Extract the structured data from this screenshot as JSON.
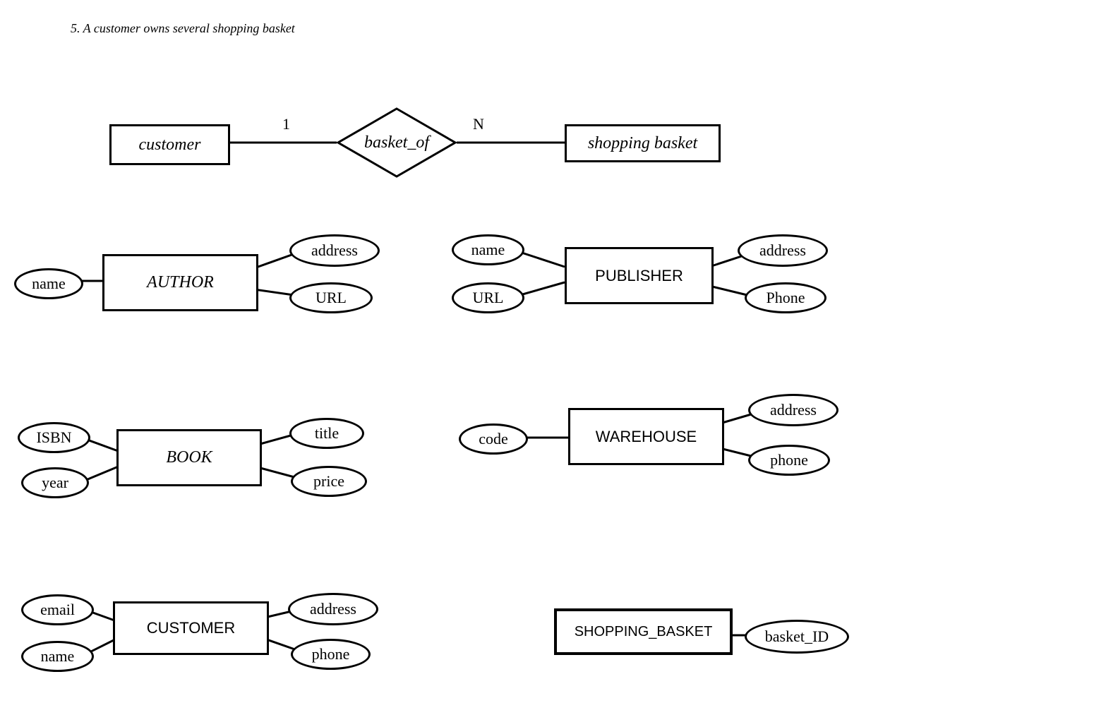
{
  "caption": "5. A customer owns several shopping basket",
  "relationship": {
    "left_entity": "customer",
    "name": "basket_of",
    "right_entity": "shopping basket",
    "left_card": "1",
    "right_card": "N"
  },
  "entities": {
    "author": {
      "label": "AUTHOR",
      "attrs": {
        "name": "name",
        "address": "address",
        "url": "URL"
      }
    },
    "publisher": {
      "label": "PUBLISHER",
      "attrs": {
        "name": "name",
        "url": "URL",
        "address": "address",
        "phone": "Phone"
      }
    },
    "book": {
      "label": "BOOK",
      "attrs": {
        "isbn": "ISBN",
        "year": "year",
        "title": "title",
        "price": "price"
      }
    },
    "warehouse": {
      "label": "WAREHOUSE",
      "attrs": {
        "code": "code",
        "address": "address",
        "phone": "phone"
      }
    },
    "customer": {
      "label": "CUSTOMER",
      "attrs": {
        "email": "email",
        "name": "name",
        "address": "address",
        "phone": "phone"
      }
    },
    "shopping_basket": {
      "label": "SHOPPING_BASKET",
      "attrs": {
        "basket_id": "basket_ID"
      }
    }
  }
}
